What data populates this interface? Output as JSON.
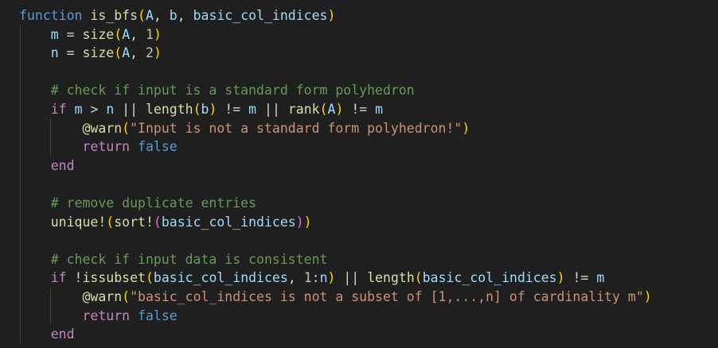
{
  "editor": {
    "theme": {
      "background": "#1f1f1f",
      "keyword": "#569cd6",
      "control": "#c586c0",
      "function": "#dcdcaa",
      "comment": "#6a9955",
      "string": "#ce9178",
      "number": "#b5cea8",
      "bracket_1": "#ffd700",
      "bracket_2": "#da70d6"
    },
    "lines": [
      [
        {
          "t": "kw",
          "v": "function"
        },
        {
          "t": "plain",
          "v": " "
        },
        {
          "t": "fn",
          "v": "is_bfs"
        },
        {
          "t": "b1",
          "v": "("
        },
        {
          "t": "id",
          "v": "A"
        },
        {
          "t": "plain",
          "v": ", "
        },
        {
          "t": "id",
          "v": "b"
        },
        {
          "t": "plain",
          "v": ", "
        },
        {
          "t": "id",
          "v": "basic_col_indices"
        },
        {
          "t": "b1",
          "v": ")"
        }
      ],
      [
        {
          "t": "plain",
          "v": "    "
        },
        {
          "t": "id",
          "v": "m"
        },
        {
          "t": "plain",
          "v": " = "
        },
        {
          "t": "fn",
          "v": "size"
        },
        {
          "t": "b1",
          "v": "("
        },
        {
          "t": "id",
          "v": "A"
        },
        {
          "t": "plain",
          "v": ", "
        },
        {
          "t": "num",
          "v": "1"
        },
        {
          "t": "b1",
          "v": ")"
        }
      ],
      [
        {
          "t": "plain",
          "v": "    "
        },
        {
          "t": "id",
          "v": "n"
        },
        {
          "t": "plain",
          "v": " = "
        },
        {
          "t": "fn",
          "v": "size"
        },
        {
          "t": "b1",
          "v": "("
        },
        {
          "t": "id",
          "v": "A"
        },
        {
          "t": "plain",
          "v": ", "
        },
        {
          "t": "num",
          "v": "2"
        },
        {
          "t": "b1",
          "v": ")"
        }
      ],
      [],
      [
        {
          "t": "plain",
          "v": "    "
        },
        {
          "t": "cmt",
          "v": "# check if input is a standard form polyhedron"
        }
      ],
      [
        {
          "t": "plain",
          "v": "    "
        },
        {
          "t": "ctrl",
          "v": "if"
        },
        {
          "t": "plain",
          "v": " "
        },
        {
          "t": "id",
          "v": "m"
        },
        {
          "t": "plain",
          "v": " > "
        },
        {
          "t": "id",
          "v": "n"
        },
        {
          "t": "plain",
          "v": " || "
        },
        {
          "t": "fn",
          "v": "length"
        },
        {
          "t": "b1",
          "v": "("
        },
        {
          "t": "id",
          "v": "b"
        },
        {
          "t": "b1",
          "v": ")"
        },
        {
          "t": "plain",
          "v": " != "
        },
        {
          "t": "id",
          "v": "m"
        },
        {
          "t": "plain",
          "v": " || "
        },
        {
          "t": "fn",
          "v": "rank"
        },
        {
          "t": "b1",
          "v": "("
        },
        {
          "t": "id",
          "v": "A"
        },
        {
          "t": "b1",
          "v": ")"
        },
        {
          "t": "plain",
          "v": " != "
        },
        {
          "t": "id",
          "v": "m"
        }
      ],
      [
        {
          "t": "plain",
          "v": "        "
        },
        {
          "t": "macro",
          "v": "@warn"
        },
        {
          "t": "b1",
          "v": "("
        },
        {
          "t": "str",
          "v": "\"Input is not a standard form polyhedron!\""
        },
        {
          "t": "b1",
          "v": ")"
        }
      ],
      [
        {
          "t": "plain",
          "v": "        "
        },
        {
          "t": "ctrl",
          "v": "return"
        },
        {
          "t": "plain",
          "v": " "
        },
        {
          "t": "bool",
          "v": "false"
        }
      ],
      [
        {
          "t": "plain",
          "v": "    "
        },
        {
          "t": "ctrl",
          "v": "end"
        }
      ],
      [],
      [
        {
          "t": "plain",
          "v": "    "
        },
        {
          "t": "cmt",
          "v": "# remove duplicate entries"
        }
      ],
      [
        {
          "t": "plain",
          "v": "    "
        },
        {
          "t": "fn",
          "v": "unique!"
        },
        {
          "t": "b1",
          "v": "("
        },
        {
          "t": "fn",
          "v": "sort!"
        },
        {
          "t": "b2",
          "v": "("
        },
        {
          "t": "id",
          "v": "basic_col_indices"
        },
        {
          "t": "b2",
          "v": ")"
        },
        {
          "t": "b1",
          "v": ")"
        }
      ],
      [],
      [
        {
          "t": "plain",
          "v": "    "
        },
        {
          "t": "cmt",
          "v": "# check if input data is consistent"
        }
      ],
      [
        {
          "t": "plain",
          "v": "    "
        },
        {
          "t": "ctrl",
          "v": "if"
        },
        {
          "t": "plain",
          "v": " !"
        },
        {
          "t": "fn",
          "v": "issubset"
        },
        {
          "t": "b1",
          "v": "("
        },
        {
          "t": "id",
          "v": "basic_col_indices"
        },
        {
          "t": "plain",
          "v": ", "
        },
        {
          "t": "num",
          "v": "1"
        },
        {
          "t": "plain",
          "v": ":"
        },
        {
          "t": "id",
          "v": "n"
        },
        {
          "t": "b1",
          "v": ")"
        },
        {
          "t": "plain",
          "v": " || "
        },
        {
          "t": "fn",
          "v": "length"
        },
        {
          "t": "b1",
          "v": "("
        },
        {
          "t": "id",
          "v": "basic_col_indices"
        },
        {
          "t": "b1",
          "v": ")"
        },
        {
          "t": "plain",
          "v": " != "
        },
        {
          "t": "id",
          "v": "m"
        }
      ],
      [
        {
          "t": "plain",
          "v": "        "
        },
        {
          "t": "macro",
          "v": "@warn"
        },
        {
          "t": "b1",
          "v": "("
        },
        {
          "t": "str",
          "v": "\"basic_col_indices is not a subset of [1,...,n] of cardinality m\""
        },
        {
          "t": "b1",
          "v": ")"
        }
      ],
      [
        {
          "t": "plain",
          "v": "        "
        },
        {
          "t": "ctrl",
          "v": "return"
        },
        {
          "t": "plain",
          "v": " "
        },
        {
          "t": "bool",
          "v": "false"
        }
      ],
      [
        {
          "t": "plain",
          "v": "    "
        },
        {
          "t": "ctrl",
          "v": "end"
        }
      ]
    ]
  }
}
